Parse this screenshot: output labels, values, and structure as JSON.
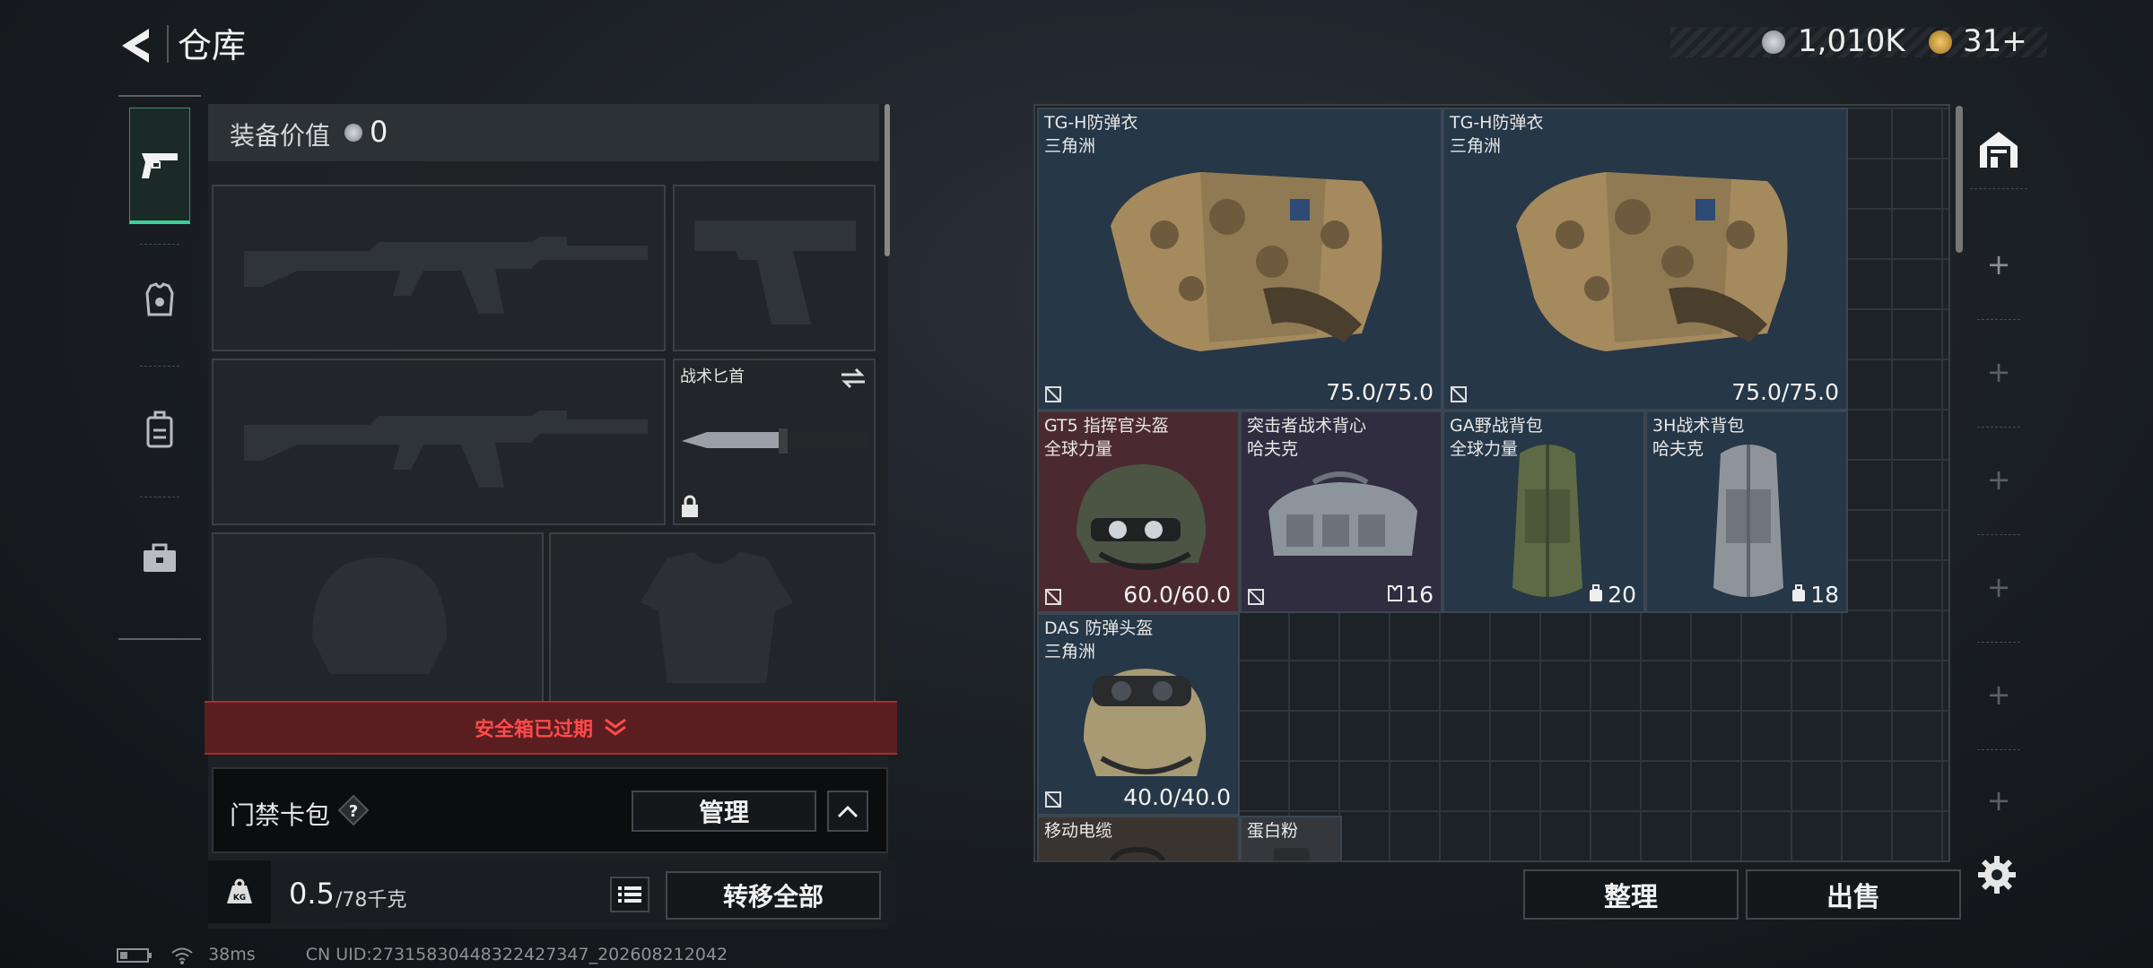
{
  "header": {
    "title": "仓库",
    "currency1": "1,010K",
    "currency2": "31+"
  },
  "loadout": {
    "equip_value_label": "装备价值",
    "equip_value": "0",
    "knife_label": "战术匕首",
    "safe_box_expired": "安全箱已过期",
    "access_card_label": "门禁卡包",
    "manage_button": "管理",
    "weight_value": "0.5",
    "weight_unit": "/78千克",
    "transfer_all_button": "转移全部"
  },
  "storage": {
    "items": [
      {
        "name": "TG-H防弹衣",
        "sub": "三角洲",
        "value": "75.0/75.0"
      },
      {
        "name": "TG-H防弹衣",
        "sub": "三角洲",
        "value": "75.0/75.0"
      },
      {
        "name": "GT5 指挥官头盔",
        "sub": "全球力量",
        "value": "60.0/60.0"
      },
      {
        "name": "突击者战术背心",
        "sub": "哈夫克",
        "value": "16"
      },
      {
        "name": "GA野战背包",
        "sub": "全球力量",
        "value": "20"
      },
      {
        "name": "3H战术背包",
        "sub": "哈夫克",
        "value": "18"
      },
      {
        "name": "DAS 防弹头盔",
        "sub": "三角洲",
        "value": "40.0/40.0"
      },
      {
        "name": "移动电缆",
        "sub": "",
        "value": ""
      },
      {
        "name": "蛋白粉",
        "sub": "",
        "value": ""
      }
    ],
    "sort_button": "整理",
    "sell_button": "出售"
  },
  "status": {
    "ping": "38ms",
    "uid": "CN UID:27315830448322427347_202608212042"
  },
  "colors": {
    "accent": "#3ad29a",
    "danger": "#e03a3a",
    "rarity_red": "#4a2a30",
    "rarity_purple": "#2f2d3f",
    "rarity_blue": "#263747"
  },
  "icons": [
    "back-arrow-icon",
    "silver-coin-icon",
    "gold-coin-icon",
    "pistol-icon",
    "armor-icon",
    "backpack-icon",
    "toolbox-icon",
    "lock-icon",
    "swap-icon",
    "question-icon",
    "chevron-up-icon",
    "chevron-down-icon",
    "weight-icon",
    "list-icon",
    "home-icon",
    "plus-icon",
    "gear-icon",
    "no-insurance-icon",
    "battery-icon",
    "wifi-icon"
  ]
}
